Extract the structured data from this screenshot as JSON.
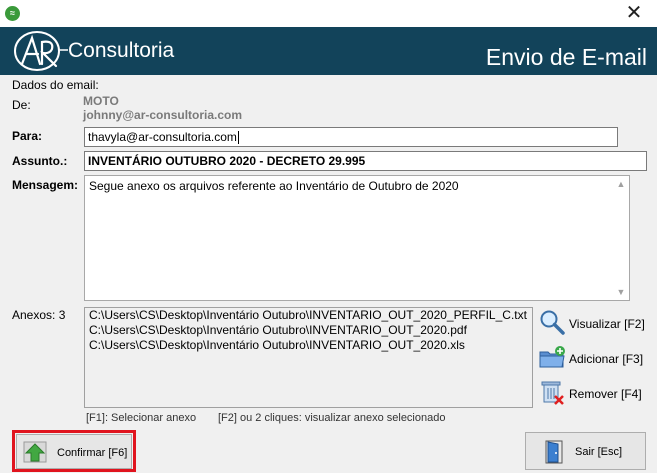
{
  "window": {
    "close_glyph": "✕",
    "app_icon_glyph": "≈"
  },
  "banner": {
    "brand": "Consultoria",
    "logo_letters": "AR",
    "title": "Envio de E-mail",
    "bg_color": "#12435a"
  },
  "form": {
    "section_title": "Dados do email:",
    "from_label": "De:",
    "from_name": "MOTO",
    "from_email": "johnny@ar-consultoria.com",
    "to_label": "Para:",
    "to_value": "thavyla@ar-consultoria.com",
    "subject_label": "Assunto.:",
    "subject_value": "INVENTÁRIO OUTUBRO 2020 - DECRETO 29.995",
    "message_label": "Mensagem:",
    "message_value": "Segue anexo os arquivos referente ao Inventário de Outubro de 2020"
  },
  "attachments": {
    "label": "Anexos: 3",
    "items": [
      "C:\\Users\\CS\\Desktop\\Inventário Outubro\\INVENTARIO_OUT_2020_PERFIL_C.txt",
      "C:\\Users\\CS\\Desktop\\Inventário Outubro\\INVENTARIO_OUT_2020.pdf",
      "C:\\Users\\CS\\Desktop\\Inventário Outubro\\INVENTARIO_OUT_2020.xls"
    ],
    "hint_select": "[F1]: Selecionar anexo",
    "hint_view": "[F2] ou 2 cliques: visualizar anexo selecionado"
  },
  "actions": {
    "view_label": "Visualizar  [F2]",
    "add_label": "Adicionar  [F3]",
    "remove_label": "Remover  [F4]",
    "confirm_label": "Confirmar [F6]",
    "exit_label": "Sair   [Esc]"
  },
  "colors": {
    "highlight": "#e0141e",
    "accent_green": "#3a9a3a"
  }
}
